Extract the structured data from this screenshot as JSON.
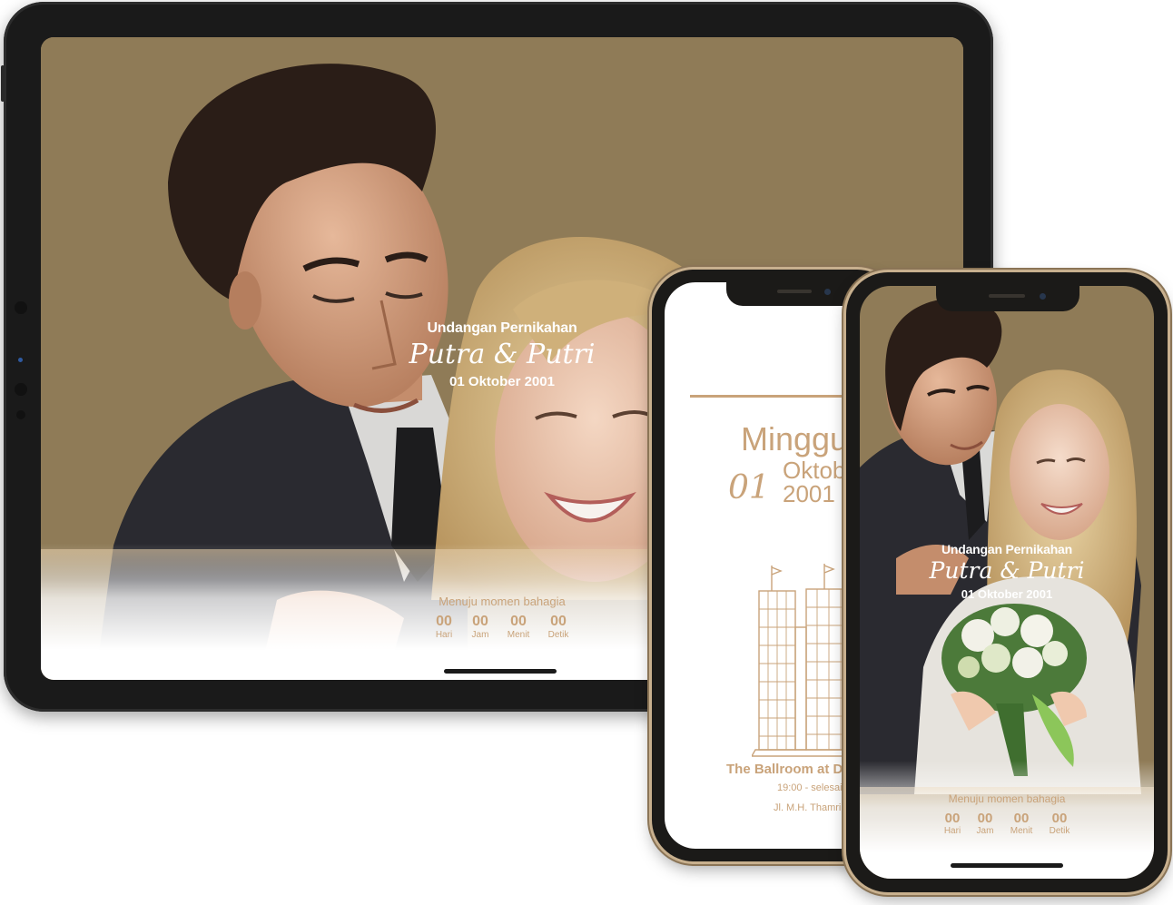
{
  "tablet": {
    "hero": {
      "subtitle": "Undangan Pernikahan",
      "names": "Putra & Putri",
      "date": "01 Oktober 2001"
    },
    "countdown": {
      "title": "Menuju momen bahagia",
      "units": [
        {
          "value": "00",
          "label": "Hari"
        },
        {
          "value": "00",
          "label": "Jam"
        },
        {
          "value": "00",
          "label": "Menit"
        },
        {
          "value": "00",
          "label": "Detik"
        }
      ]
    }
  },
  "phone_back": {
    "day": "Minggu",
    "day_number": "01",
    "month": "Oktober",
    "year": "2001",
    "venue": "The Ballroom at Dj",
    "time": "19:00 - selesai",
    "address": "Jl. M.H. Thamrin"
  },
  "phone_front": {
    "hero": {
      "subtitle": "Undangan Pernikahan",
      "names": "Putra & Putri",
      "date": "01 Oktober 2001"
    },
    "countdown": {
      "title": "Menuju momen bahagia",
      "units": [
        {
          "value": "00",
          "label": "Hari"
        },
        {
          "value": "00",
          "label": "Jam"
        },
        {
          "value": "00",
          "label": "Menit"
        },
        {
          "value": "00",
          "label": "Detik"
        }
      ]
    }
  },
  "colors": {
    "photo_background": "#8f7b57",
    "accent_gold": "#c9a37a",
    "device_frame": "#1b1a18"
  }
}
